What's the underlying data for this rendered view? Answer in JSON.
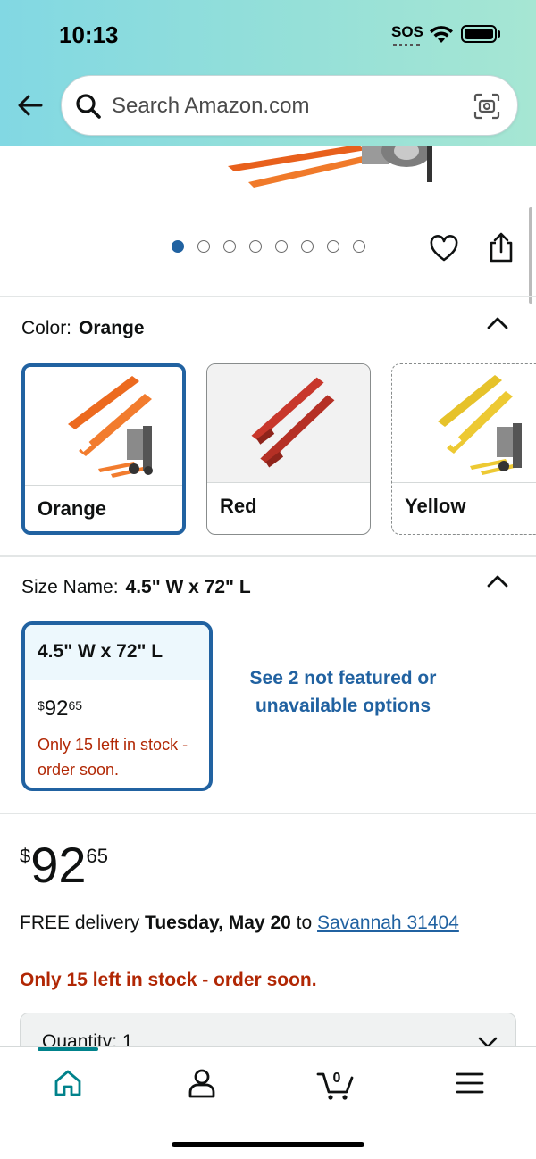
{
  "status_bar": {
    "time": "10:13",
    "sos": "SOS"
  },
  "header": {
    "search_placeholder": "Search Amazon.com"
  },
  "carousel": {
    "image_count": 8,
    "active_index": 0
  },
  "color": {
    "label": "Color:",
    "selected": "Orange",
    "options": [
      {
        "name": "Orange",
        "selected": true,
        "available": true
      },
      {
        "name": "Red",
        "selected": false,
        "available": true
      },
      {
        "name": "Yellow",
        "selected": false,
        "available": false
      }
    ]
  },
  "size": {
    "label": "Size Name:",
    "selected": "4.5\" W x 72\" L",
    "card": {
      "name": "4.5\" W x 72\" L",
      "price_currency": "$",
      "price_whole": "92",
      "price_fraction": "65",
      "stock": "Only 15 left in stock - order soon."
    },
    "see_more": "See 2 not featured or unavailable options"
  },
  "price": {
    "currency": "$",
    "whole": "92",
    "fraction": "65"
  },
  "delivery": {
    "prefix": "FREE delivery ",
    "date": "Tuesday, May 20",
    "to": " to ",
    "location": "Savannah 31404"
  },
  "stock_message": "Only 15 left in stock - order soon.",
  "quantity": {
    "label": "Quantity: 1"
  },
  "cart": {
    "count": "0"
  },
  "colors": {
    "link_blue": "#2162a1",
    "stock_red": "#b12704",
    "teal_accent": "#00828b"
  }
}
